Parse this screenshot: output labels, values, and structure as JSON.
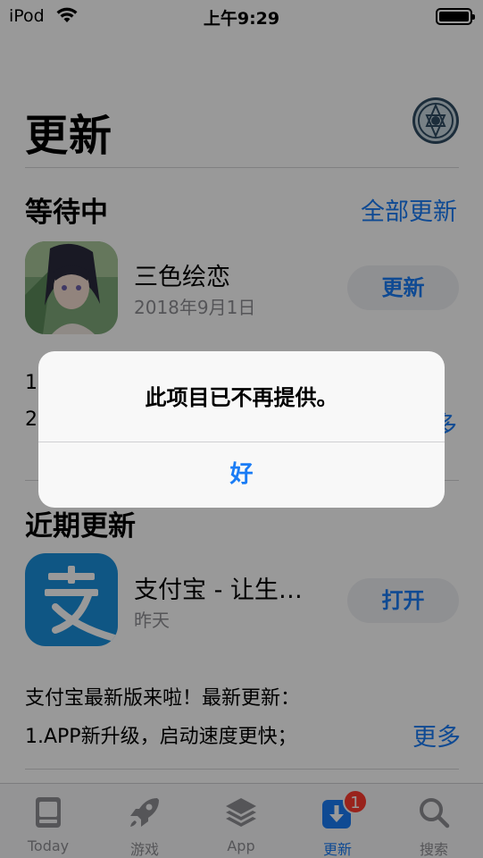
{
  "status_bar": {
    "carrier": "iPod",
    "time": "上午9:29"
  },
  "header": {
    "title": "更新"
  },
  "pending": {
    "title": "等待中",
    "update_all": "全部更新",
    "app": {
      "name": "三色绘恋",
      "date": "2018年9月1日",
      "action": "更新"
    },
    "desc_line1": "1",
    "desc_line2": "2",
    "more": "多"
  },
  "recent": {
    "title": "近期更新",
    "app": {
      "name": "支付宝 - 让生…",
      "date": "昨天",
      "action": "打开"
    },
    "desc_line1": "支付宝最新版来啦！最新更新：",
    "desc_line2": "1.APP新升级，启动速度更快；",
    "more": "更多"
  },
  "tabs": [
    {
      "label": "Today",
      "icon": "today-icon",
      "active": false
    },
    {
      "label": "游戏",
      "icon": "rocket-icon",
      "active": false
    },
    {
      "label": "App",
      "icon": "layers-icon",
      "active": false
    },
    {
      "label": "更新",
      "icon": "download-icon",
      "active": true,
      "badge": "1"
    },
    {
      "label": "搜索",
      "icon": "search-icon",
      "active": false
    }
  ],
  "alert": {
    "message": "此项目已不再提供。",
    "button": "好"
  },
  "colors": {
    "accent": "#1a7cf5",
    "badge": "#ff3b30",
    "alipay": "#1a8fdd"
  }
}
